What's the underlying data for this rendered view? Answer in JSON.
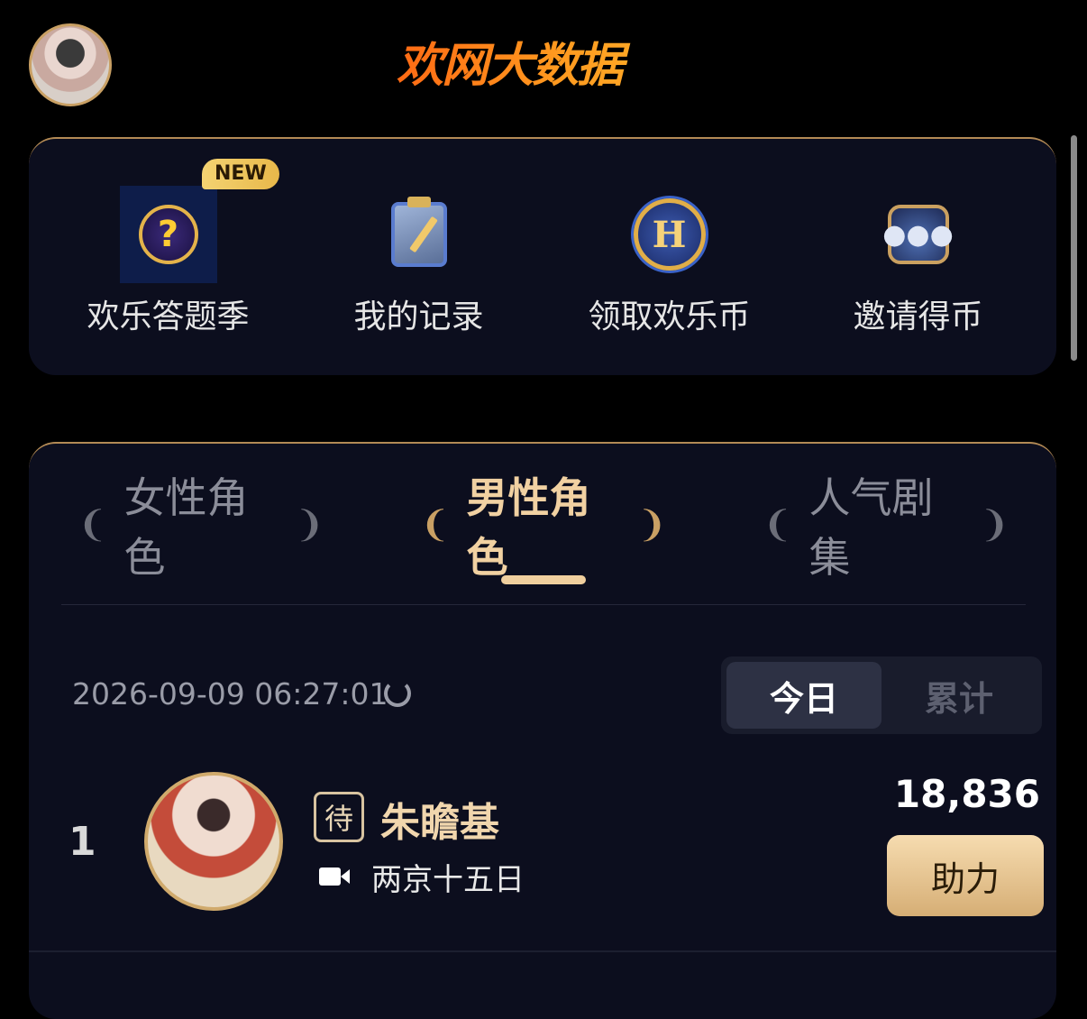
{
  "header": {
    "logo_text": "欢网大数据"
  },
  "menu": {
    "items": [
      {
        "label": "欢乐答题季",
        "icon": "quiz-question-icon",
        "badge": "NEW"
      },
      {
        "label": "我的记录",
        "icon": "clipboard-record-icon"
      },
      {
        "label": "领取欢乐币",
        "icon": "coin-h-icon",
        "icon_text": "H"
      },
      {
        "label": "邀请得币",
        "icon": "invite-people-icon"
      }
    ]
  },
  "ranking": {
    "tabs": [
      {
        "label": "女性角色",
        "active": false
      },
      {
        "label": "男性角色",
        "active": true
      },
      {
        "label": "人气剧集",
        "active": false
      }
    ],
    "timestamp": "2026-09-09 06:27:01",
    "period_toggle": {
      "today": "今日",
      "cumulative": "累计",
      "selected": "今日"
    },
    "entries": [
      {
        "rank": "1",
        "status": "待",
        "name": "朱瞻基",
        "drama": "两京十五日",
        "score": "18,836",
        "action": "助力"
      }
    ]
  },
  "colors": {
    "accent_gold": "#c9a064",
    "card_bg": "#0c0e1e",
    "logo_orange": "#ff8a1c"
  }
}
